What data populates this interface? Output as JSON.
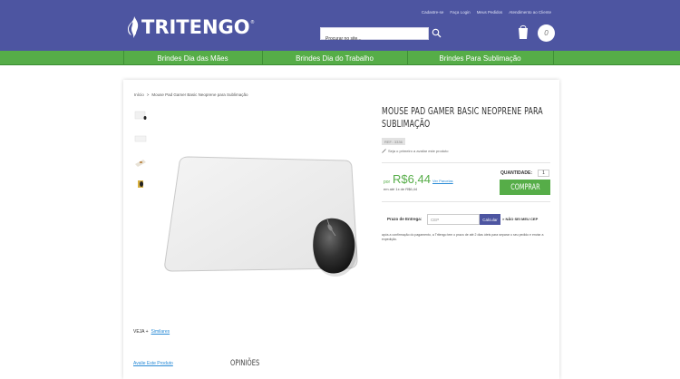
{
  "header": {
    "top_links": [
      "Cadastre-se",
      "Faça Login",
      "Meus Pedidos",
      "Atendimento ao Cliente"
    ],
    "logo_text": "TRITENGO",
    "logo_reg": "®",
    "search_placeholder": "Procurar no site...",
    "cart_count": "0",
    "colors": {
      "header_bg": "#4d55a1",
      "nav_bg": "#56ad48"
    }
  },
  "nav": {
    "items": [
      {
        "label": "Brindes Dia das Mães"
      },
      {
        "label": "Brindes Dia do Trabalho"
      },
      {
        "label": "Brindes Para Sublimação"
      }
    ]
  },
  "breadcrumb": {
    "home": "Início",
    "separator": ">",
    "current": "Mouse Pad Gamer Basic Neoprene para Sublimação"
  },
  "product": {
    "title": "MOUSE PAD GAMER BASIC NEOPRENE PARA SUBLIMAÇÃO",
    "ref": "REF.: 3336",
    "review_first": "Seja o primeiro a avaliar este produto",
    "price_prefix": "por",
    "price": "R$6,44",
    "installments_link": "Ver Parcelas",
    "installments": "em até 1x de R$6,44",
    "quantity_label": "QUANTIDADE:",
    "quantity_value": "1",
    "buy_label": "COMPRAR",
    "thumbnails": [
      "mouse-pad-thumb",
      "mouse-pad-flat-thumb",
      "mouse-pad-print-thumb",
      "mouse-pad-mouse-thumb"
    ]
  },
  "shipping": {
    "label": "Prazo de Entrega:",
    "cep_placeholder": "CEP",
    "calc_label": "Calcular",
    "no_cep": "> NÃO SEI MEU CEP",
    "note": "após a confirmação do pagamento, a Tritengo tem o prazo de até 2 dias úteis para separar o seu pedido e enviar a expedição."
  },
  "footer": {
    "veja_label": "VEJA +",
    "similares": "Similares",
    "avalie": "Avalie Este Produto",
    "opinioes": "OPINIÕES"
  }
}
